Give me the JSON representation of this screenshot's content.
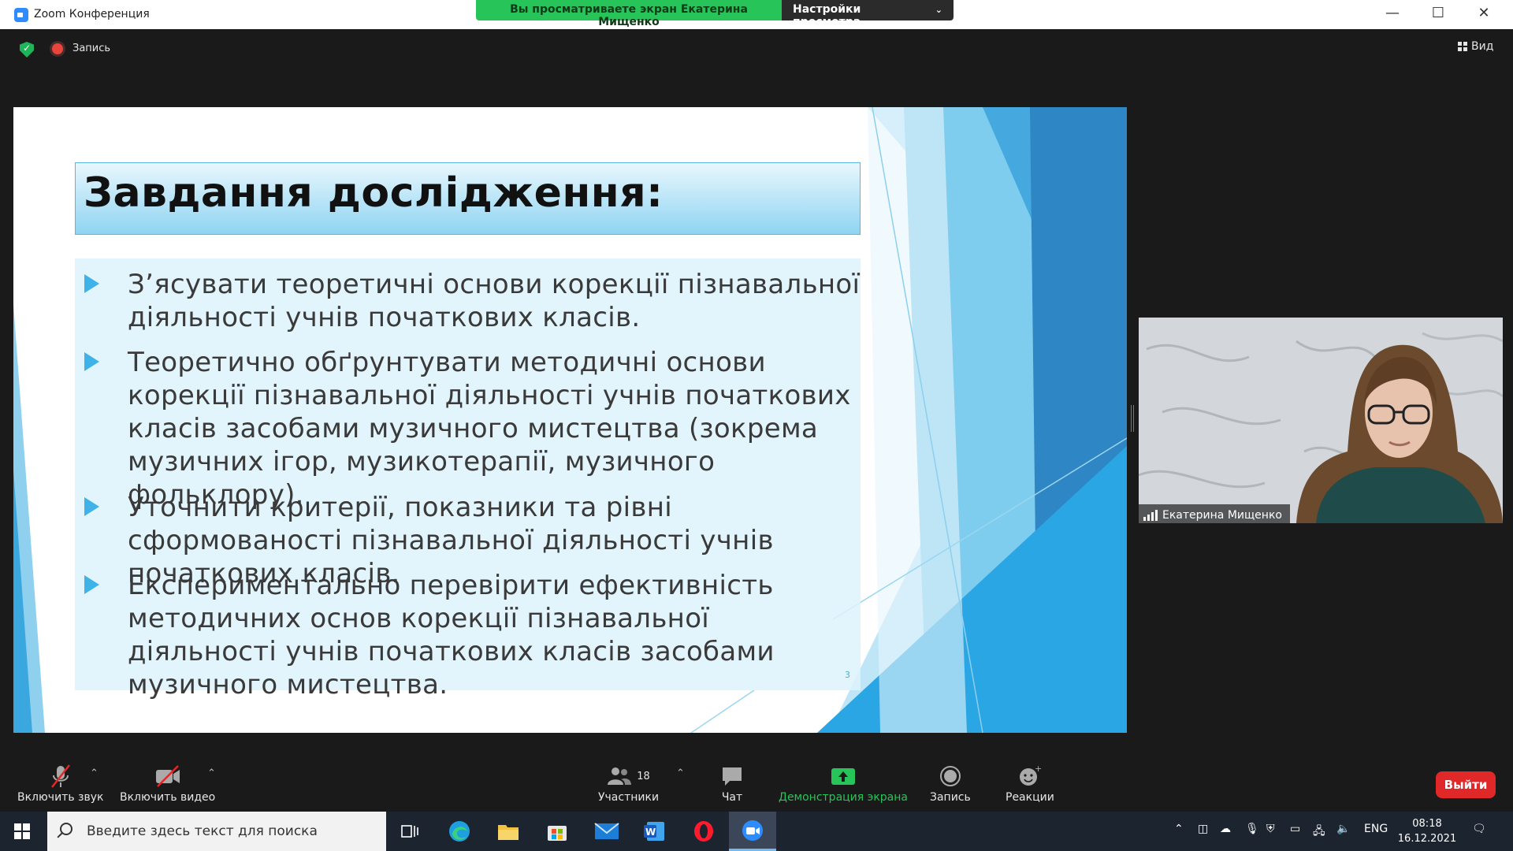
{
  "window": {
    "title": "Zoom Конференция",
    "share_banner": "Вы просматриваете экран Екатерина Мищенко",
    "view_settings": "Настройки просмотра",
    "controls": [
      "—",
      "☐",
      "✕"
    ]
  },
  "top_strip": {
    "recording_label": "Запись",
    "view_label": "Вид"
  },
  "slide": {
    "title": "Завдання дослідження:",
    "bullets": [
      "З’ясувати теоретичні основи корекції пізнавальної діяльності учнів початкових класів.",
      "Теоретично обґрунтувати методичні основи корекції пізнавальної діяльності учнів початкових класів засобами музичного мистецтва (зокрема музичних ігор, музикотерапії, музичного фольклору).",
      "Уточнити критерії, показники та рівні сформованості пізнавальної діяльності учнів початкових класів.",
      "Експериментально перевірити ефективність методичних основ корекції пізнавальної діяльності учнів початкових класів засобами музичного мистецтва."
    ],
    "page_number": "3",
    "accent_color": "#3fb2e8"
  },
  "participant": {
    "name": "Екатерина Мищенко"
  },
  "toolbar": {
    "unmute": "Включить звук",
    "start_video": "Включить видео",
    "participants": "Участники",
    "participants_count": "18",
    "chat": "Чат",
    "share_screen": "Демонстрация экрана",
    "record": "Запись",
    "reactions": "Реакции",
    "leave": "Выйти",
    "share_color": "#27c45a",
    "leave_color": "#e02828"
  },
  "taskbar": {
    "search_placeholder": "Введите здесь текст для поиска",
    "language": "ENG",
    "time": "08:18",
    "date": "16.12.2021"
  }
}
